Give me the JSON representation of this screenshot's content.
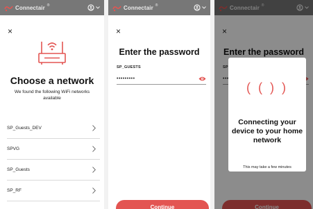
{
  "app": {
    "brand": "Connectair",
    "reg_mark": "®"
  },
  "colors": {
    "accent": "#e35552",
    "topbar": "#777777"
  },
  "screen1": {
    "close": "×",
    "title": "Choose a network",
    "subtitle": "We found the following WiFi networks available",
    "networks": [
      {
        "ssid": "SP_Guests_DEV"
      },
      {
        "ssid": "SPVG"
      },
      {
        "ssid": "SP_Guests"
      },
      {
        "ssid": "SP_RF"
      }
    ]
  },
  "screen2": {
    "close": "×",
    "title": "Enter the password",
    "ssid": "SP_GUESTS",
    "password_mask": "•••••••••",
    "continue": "Continue"
  },
  "screen3": {
    "close": "×",
    "bg_title": "Enter the password",
    "bg_ssid": "SP_",
    "spinner": "( ( ) )",
    "modal_title": "Connecting your device to your home network",
    "modal_note": "This may take a few minutes",
    "continue": "Continue"
  }
}
